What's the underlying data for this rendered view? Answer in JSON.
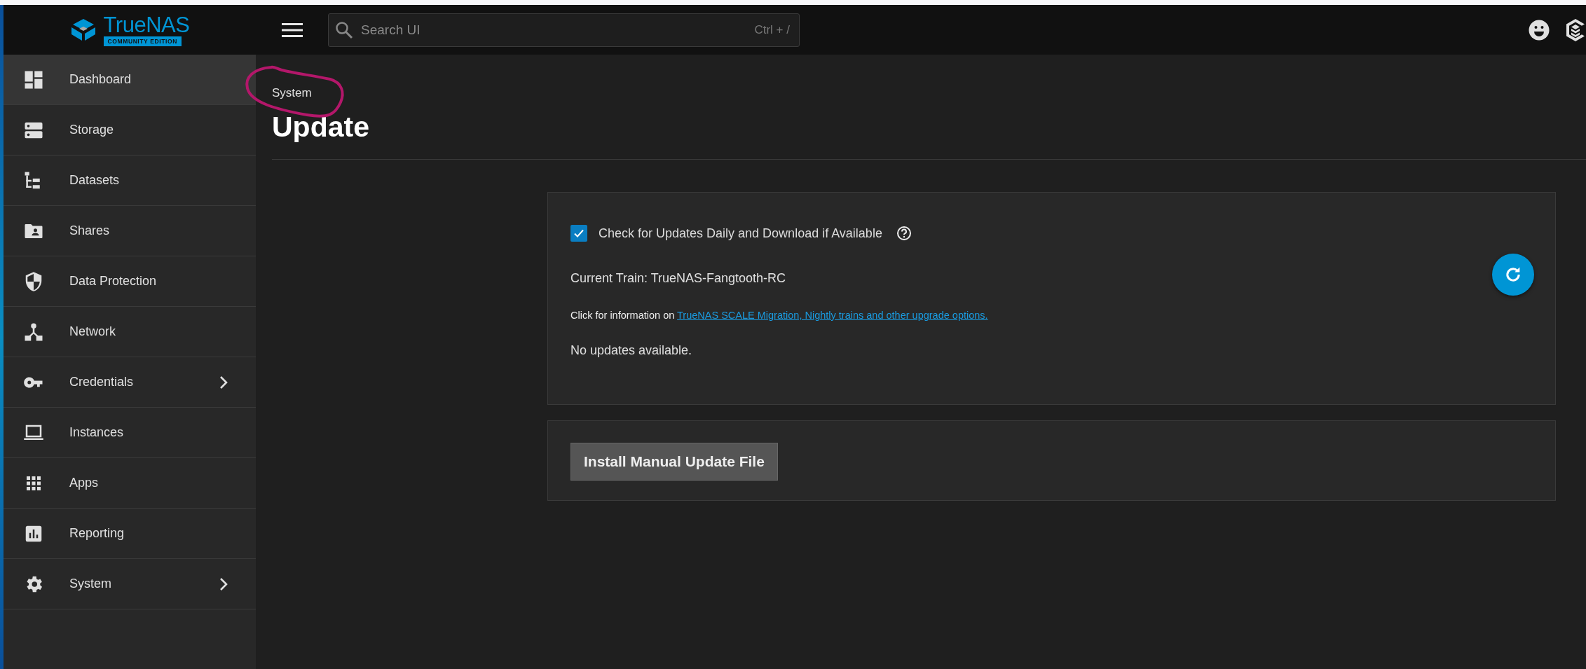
{
  "header": {
    "logo": {
      "name": "TrueNAS",
      "edition": "COMMUNITY EDITION"
    },
    "search": {
      "placeholder": "Search UI",
      "shortcut": "Ctrl + /"
    }
  },
  "sidebar": {
    "items": [
      {
        "label": "Dashboard",
        "selected": true,
        "has_submenu": false
      },
      {
        "label": "Storage",
        "selected": false,
        "has_submenu": false
      },
      {
        "label": "Datasets",
        "selected": false,
        "has_submenu": false
      },
      {
        "label": "Shares",
        "selected": false,
        "has_submenu": false
      },
      {
        "label": "Data Protection",
        "selected": false,
        "has_submenu": false
      },
      {
        "label": "Network",
        "selected": false,
        "has_submenu": false
      },
      {
        "label": "Credentials",
        "selected": false,
        "has_submenu": true
      },
      {
        "label": "Instances",
        "selected": false,
        "has_submenu": false
      },
      {
        "label": "Apps",
        "selected": false,
        "has_submenu": false
      },
      {
        "label": "Reporting",
        "selected": false,
        "has_submenu": false
      },
      {
        "label": "System",
        "selected": false,
        "has_submenu": true
      }
    ]
  },
  "page": {
    "breadcrumb": "System",
    "title": "Update"
  },
  "update_card": {
    "auto_check": {
      "label": "Check for Updates Daily and Download if Available",
      "checked": true
    },
    "current_train": "Current Train: TrueNAS-Fangtooth-RC",
    "info_text": "Click for information on ",
    "info_link": "TrueNAS SCALE Migration, Nightly trains and other upgrade options.",
    "status": "No updates available."
  },
  "manual_card": {
    "button": "Install Manual Update File"
  }
}
